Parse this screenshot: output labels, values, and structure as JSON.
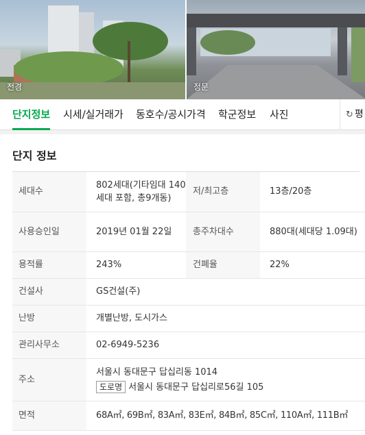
{
  "photos": {
    "left_label": "전경",
    "right_label": "정문"
  },
  "tabs": [
    {
      "label": "단지정보",
      "active": true
    },
    {
      "label": "시세/실거래가",
      "active": false
    },
    {
      "label": "동호수/공시가격",
      "active": false
    },
    {
      "label": "학군정보",
      "active": false
    },
    {
      "label": "사진",
      "active": false
    }
  ],
  "tab_more": {
    "label": "평",
    "icon": "refresh-icon"
  },
  "section": {
    "title": "단지 정보"
  },
  "info": {
    "households_label": "세대수",
    "households_value": "802세대(기타임대 140세대 포함, 총9개동)",
    "floors_label": "저/최고층",
    "floors_value": "13층/20층",
    "approval_label": "사용승인일",
    "approval_value": "2019년 01월 22일",
    "parking_label": "총주차대수",
    "parking_value": "880대(세대당 1.09대)",
    "far_label": "용적률",
    "far_value": "243%",
    "bcr_label": "건폐율",
    "bcr_value": "22%",
    "builder_label": "건설사",
    "builder_value": "GS건설(주)",
    "heating_label": "난방",
    "heating_value": "개별난방, 도시가스",
    "office_label": "관리사무소",
    "office_value": "02-6949-5236",
    "address_label": "주소",
    "address_value": "서울시 동대문구 답십리동 1014",
    "road_badge": "도로명",
    "road_address": "서울시 동대문구 답십리로56길 105",
    "area_label": "면적",
    "area_value": "68A㎡, 69B㎡, 83A㎡, 83E㎡, 84B㎡, 85C㎡, 110A㎡, 111B㎡"
  },
  "colors": {
    "accent": "#03a94d",
    "header_bg": "#f7f7f7",
    "gap_bg": "#f2f2f2"
  }
}
